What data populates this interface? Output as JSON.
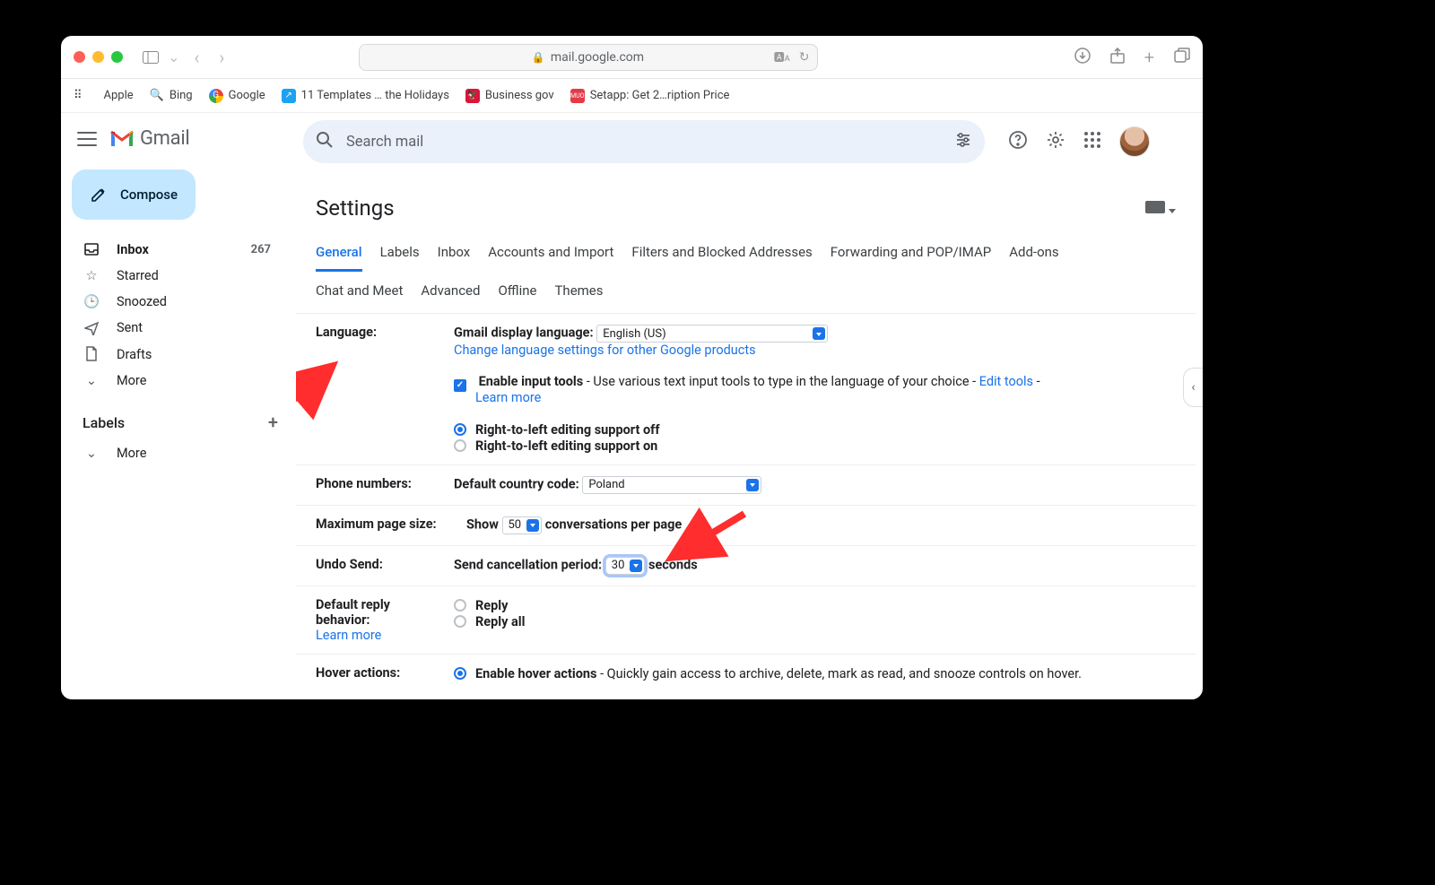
{
  "browser": {
    "url_host": "mail.google.com",
    "favorites": [
      {
        "label": "Apple",
        "icon": "apple"
      },
      {
        "label": "Bing",
        "icon": "bing"
      },
      {
        "label": "Google",
        "icon": "google"
      },
      {
        "label": "11 Templates … the Holidays",
        "icon": "blue"
      },
      {
        "label": "Business gov",
        "icon": "pl"
      },
      {
        "label": "Setapp: Get 2…ription Price",
        "icon": "red"
      }
    ]
  },
  "gmail": {
    "brand": "Gmail",
    "compose": "Compose",
    "search_placeholder": "Search mail",
    "inbox_count": "267",
    "nav": {
      "inbox": "Inbox",
      "starred": "Starred",
      "snoozed": "Snoozed",
      "sent": "Sent",
      "drafts": "Drafts",
      "more": "More"
    },
    "labels_header": "Labels",
    "labels_more": "More"
  },
  "settings": {
    "title": "Settings",
    "tabs_row1": [
      "General",
      "Labels",
      "Inbox",
      "Accounts and Import",
      "Filters and Blocked Addresses",
      "Forwarding and POP/IMAP",
      "Add-ons"
    ],
    "tabs_row2": [
      "Chat and Meet",
      "Advanced",
      "Offline",
      "Themes"
    ],
    "active_tab": "General",
    "language": {
      "label": "Language:",
      "display_label": "Gmail display language:",
      "display_value": "English (US)",
      "change_link": "Change language settings for other Google products",
      "enable_input_label": "Enable input tools",
      "enable_input_desc": " - Use various text input tools to type in the language of your choice - ",
      "edit_tools": "Edit tools",
      "dash": " - ",
      "learn_more": "Learn more",
      "rtl_off": "Right-to-left editing support off",
      "rtl_on": "Right-to-left editing support on"
    },
    "phone": {
      "label": "Phone numbers:",
      "cc_label": "Default country code:",
      "cc_value": "Poland"
    },
    "page_size": {
      "label": "Maximum page size:",
      "show": "Show",
      "value": "50",
      "suffix": "conversations per page"
    },
    "undo": {
      "label": "Undo Send:",
      "period_label": "Send cancellation period:",
      "value": "30",
      "seconds": "seconds"
    },
    "reply": {
      "label": "Default reply behavior:",
      "learn_more": "Learn more",
      "reply": "Reply",
      "reply_all": "Reply all"
    },
    "hover": {
      "label": "Hover actions:",
      "enable": "Enable hover actions",
      "desc": " - Quickly gain access to archive, delete, mark as read, and snooze controls on hover."
    }
  }
}
